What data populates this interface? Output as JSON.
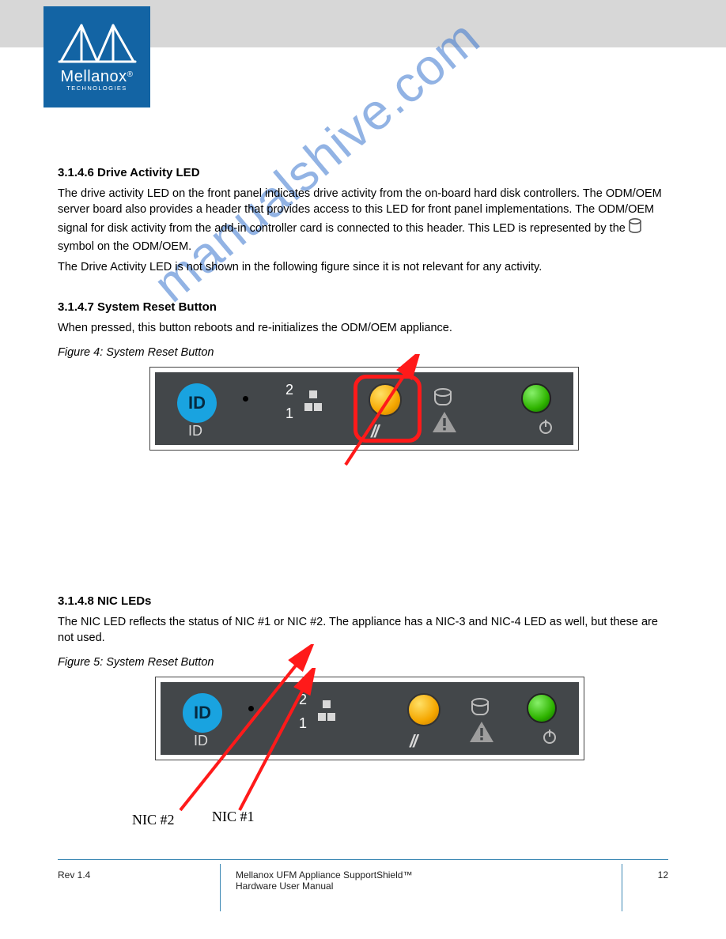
{
  "logo": {
    "brand": "Mellanox",
    "sub": "TECHNOLOGIES"
  },
  "body": {
    "sec1_heading": "3.1.4.6 Drive Activity LED",
    "sec1_p1_a": "The drive activity LED on the front panel indicates drive activity from the on-board hard disk controllers. The ODM/OEM server board also provides a header that provides access to this LED for front panel implementations. The ODM/OEM signal for disk activity from the add-in controller card is connected to this header. This LED is represented by the ",
    "sec1_p1_b": " symbol on the ODM/OEM.",
    "sec1_p2": "The Drive Activity LED is not shown in the following figure since it is not relevant for any activity.",
    "sec2_heading": "3.1.4.7 System Reset Button",
    "sec2_p1": "When pressed, this button reboots and re-initializes the ODM/OEM appliance.",
    "fig4_cap": "Figure 4: System Reset Button",
    "sec3_heading": "3.1.4.8 NIC LEDs",
    "sec3_p1": "The NIC LED reflects the status of NIC #1 or NIC #2. The appliance has a NIC-3 and NIC-4 LED as well, but these are not used.",
    "fig5_cap": "Figure 5: System Reset Button",
    "nic2": "NIC #2",
    "nic1": "NIC #1",
    "panel_id": "ID",
    "panel_id_label": "ID",
    "panel_n1": "1",
    "panel_n2": "2"
  },
  "footer": {
    "rev": "Rev 1.4",
    "center_line1": "Mellanox UFM Appliance SupportShield™",
    "center_line2": "Hardware User Manual",
    "page": "12"
  },
  "watermark": "manualshive.com"
}
